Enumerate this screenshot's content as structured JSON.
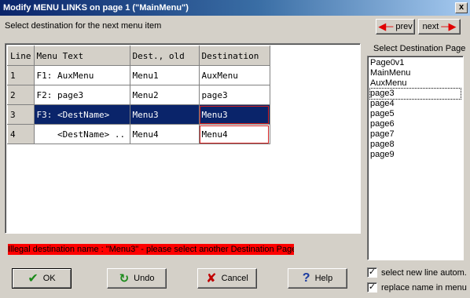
{
  "window": {
    "title": "Modify MENU LINKS on page 1 (\"MainMenu\")",
    "close_label": "x"
  },
  "instruction": "Select destination  for the next menu item",
  "nav": {
    "prev_label": "prev",
    "next_label": "next"
  },
  "grid": {
    "headers": [
      "Line",
      "Menu Text",
      "Dest., old",
      "Destination"
    ],
    "rows": [
      {
        "line": "1",
        "menu_text": "F1: AuxMenu",
        "dest_old": "Menu1",
        "destination": "AuxMenu"
      },
      {
        "line": "2",
        "menu_text": "F2: page3",
        "dest_old": "Menu2",
        "destination": "page3"
      },
      {
        "line": "3",
        "menu_text": "F3: <DestName>",
        "dest_old": "Menu3",
        "destination": "Menu3"
      },
      {
        "line": "4",
        "menu_text": "    <DestName> ..",
        "dest_old": "Menu4",
        "destination": "Menu4"
      }
    ],
    "selected_line": "3"
  },
  "error_message": "Illegal destination name : \"Menu3\"  - please select another Destination Page",
  "buttons": {
    "ok": "OK",
    "undo": "Undo",
    "cancel": "Cancel",
    "help": "Help"
  },
  "destination_list": {
    "label": "Select Destination Page",
    "items": [
      "Page0v1",
      "MainMenu",
      "AuxMenu",
      "page3",
      "page4",
      "page5",
      "page6",
      "page7",
      "page8",
      "page9"
    ],
    "focused": "page3"
  },
  "options": {
    "auto_select_label": "select new line autom.",
    "auto_select_checked": true,
    "replace_name_label": "replace name in menu",
    "replace_name_checked": true
  },
  "colors": {
    "title_bar": "#0a246a",
    "selection": "#0a246a",
    "error_bg": "#ff0000",
    "highlight_border": "#d02020"
  },
  "icons": {
    "prev": "left-arrow-icon",
    "next": "right-arrow-icon",
    "ok": "checkmark-icon",
    "undo": "undo-icon",
    "cancel": "cancel-x-icon",
    "help": "question-mark-icon"
  }
}
